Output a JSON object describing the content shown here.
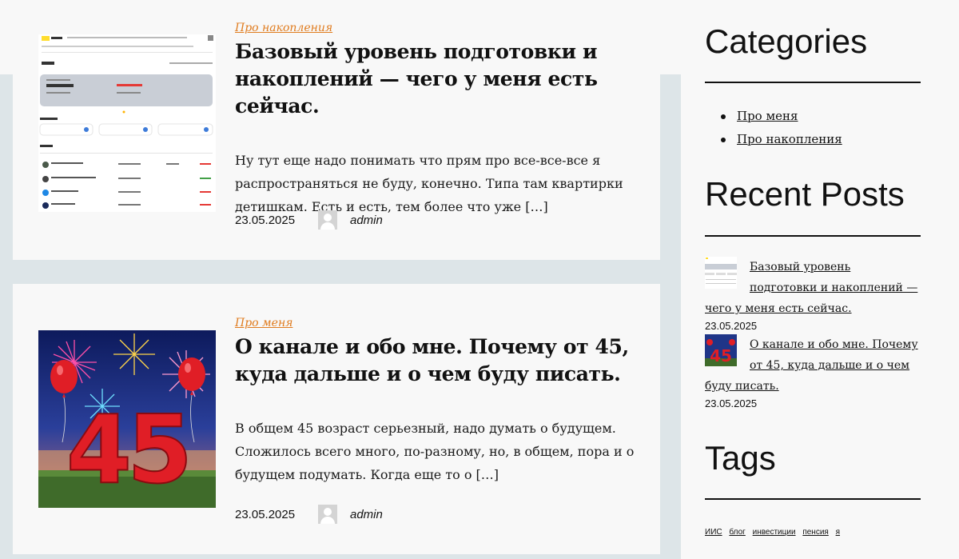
{
  "posts": [
    {
      "category": "Про накопления",
      "title": "Базовый уровень подготовки и накоплений — чего у меня есть сейчас.",
      "excerpt": "Ну тут еще надо понимать что прям про все-все-все я распространяться не буду, конечно. Типа там квартирки детишкам. Есть и есть, тем более что уже […]",
      "date": "23.05.2025",
      "author": "admin"
    },
    {
      "category": "Про меня",
      "title": "О канале и обо мне. Почему от 45, куда дальше и о чем буду писать.",
      "excerpt": "В общем 45 возраст серьезный, надо думать о будущем. Сложилось всего много, по-разному, но, в общем, пора и о будущем подумать. Когда еще то о […]",
      "date": "23.05.2025",
      "author": "admin",
      "image_text": "45"
    }
  ],
  "sidebar": {
    "categories_title": "Categories",
    "categories": [
      "Про меня",
      "Про накопления"
    ],
    "recent_title": "Recent Posts",
    "recent": [
      {
        "title": "Базовый уровень подготовки и накоплений — чего у меня есть сейчас.",
        "date": "23.05.2025"
      },
      {
        "title": "О канале и обо мне. Почему от 45, куда дальше и о чем буду писать.",
        "date": "23.05.2025"
      }
    ],
    "tags_title": "Tags",
    "tags": [
      "ИИС",
      "блог",
      "инвестиции",
      "пенсия",
      "я"
    ]
  },
  "colors": {
    "accent": "#e07c1f",
    "page_bg": "#dde5e8",
    "card_bg": "#f8f8f8"
  }
}
